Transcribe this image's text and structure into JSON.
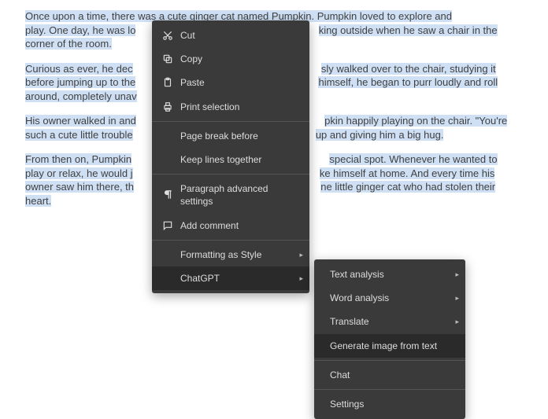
{
  "story": {
    "p1a": "Once upon a time, there was a cute ginger cat named Pumpkin. Pumpkin loved to explore and",
    "p1b": "play. One day, he was lo",
    "p1c": "king outside when he saw a chair in the",
    "p1d": "corner of the room.",
    "p2a": "Curious as ever, he dec",
    "p2b": "sly walked over to the chair, studying it",
    "p2c": "before jumping up to the",
    "p2d": "himself, he began to purr loudly and roll",
    "p2e": "around, completely unav",
    "p3a": "His owner walked in and",
    "p3b": "pkin happily playing on the chair. \"You're",
    "p3c": "such a cute little trouble",
    "p3d": "up and giving him a big hug.",
    "p4a": "From then on, Pumpkin",
    "p4b": "special spot. Whenever he wanted to",
    "p4c": "play or relax, he would j",
    "p4d": "ke himself at home. And every time his",
    "p4e": "owner saw him there, th",
    "p4f": "ne little ginger cat who had stolen their",
    "p4g": "heart."
  },
  "menu": {
    "cut": "Cut",
    "copy": "Copy",
    "paste": "Paste",
    "print": "Print selection",
    "pageBreak": "Page break before",
    "keepLines": "Keep lines together",
    "paraAdv": "Paragraph advanced settings",
    "addComment": "Add comment",
    "fmtStyle": "Formatting as Style",
    "chatgpt": "ChatGPT"
  },
  "submenu": {
    "textAnalysis": "Text analysis",
    "wordAnalysis": "Word analysis",
    "translate": "Translate",
    "genImage": "Generate image from text",
    "chat": "Chat",
    "settings": "Settings"
  }
}
